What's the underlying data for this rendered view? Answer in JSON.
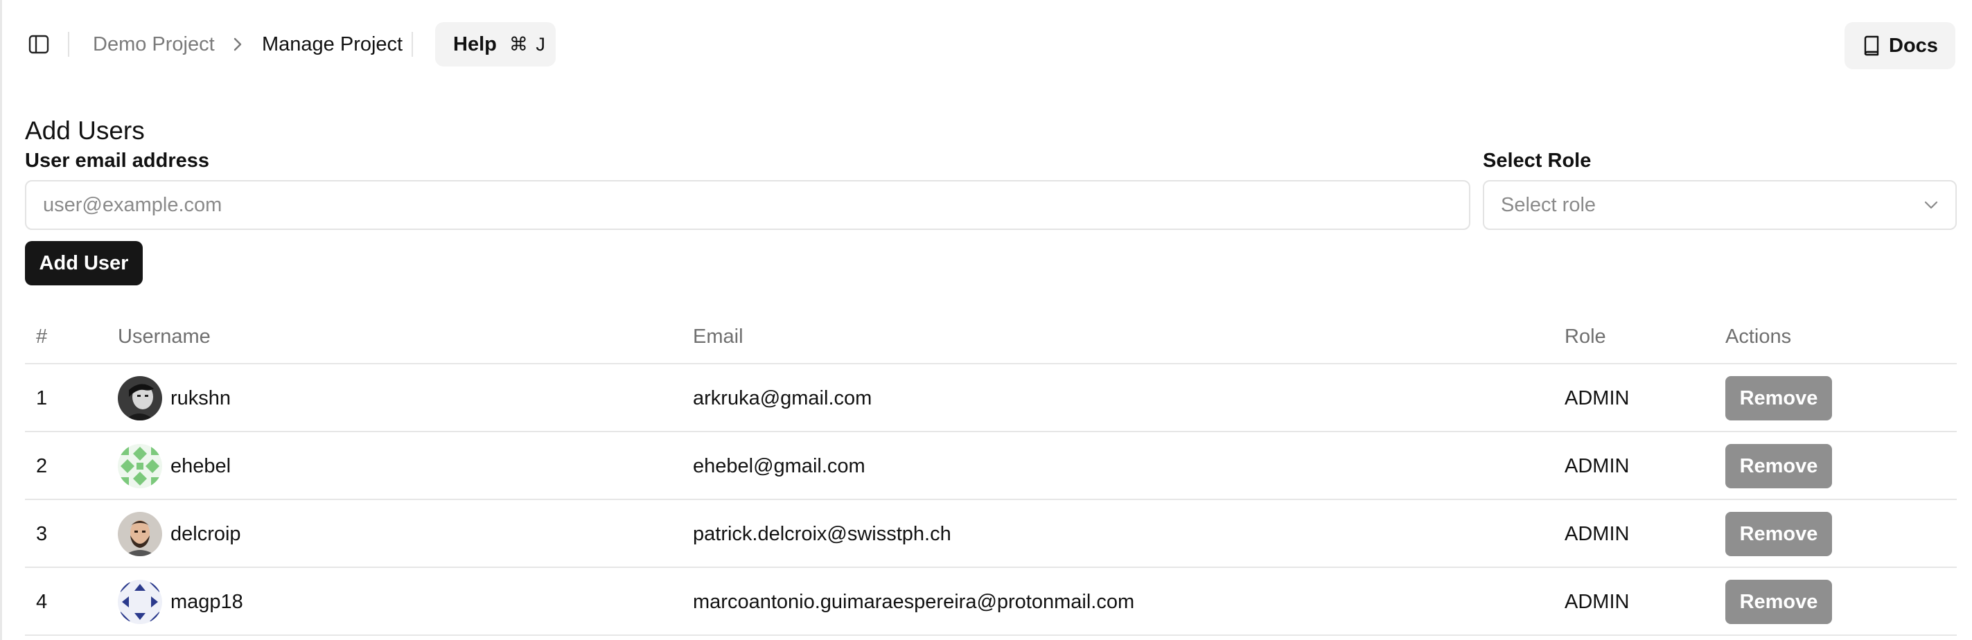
{
  "header": {
    "breadcrumb": [
      "Demo Project",
      "Manage Project"
    ],
    "help_label": "Help",
    "help_shortcut": "⌘ J",
    "docs_label": "Docs"
  },
  "form": {
    "title": "Add Users",
    "email_label": "User email address",
    "email_placeholder": "user@example.com",
    "email_value": "",
    "role_label": "Select Role",
    "role_placeholder": "Select role",
    "submit_label": "Add User"
  },
  "table": {
    "columns": [
      "#",
      "Username",
      "Email",
      "Role",
      "Actions"
    ],
    "rows": [
      {
        "index": "1",
        "username": "rukshn",
        "email": "arkruka@gmail.com",
        "role": "ADMIN",
        "action": "Remove",
        "avatar": "photo-portrait-bw"
      },
      {
        "index": "2",
        "username": "ehebel",
        "email": "ehebel@gmail.com",
        "role": "ADMIN",
        "action": "Remove",
        "avatar": "identicon-green"
      },
      {
        "index": "3",
        "username": "delcroip",
        "email": "patrick.delcroix@swisstph.ch",
        "role": "ADMIN",
        "action": "Remove",
        "avatar": "photo-portrait"
      },
      {
        "index": "4",
        "username": "magp18",
        "email": "marcoantonio.guimaraespereira@protonmail.com",
        "role": "ADMIN",
        "action": "Remove",
        "avatar": "identicon-navy"
      }
    ]
  },
  "colors": {
    "primary_button": "#161616",
    "remove_button": "#8f8f8f",
    "muted_text": "#7a7a7a",
    "border": "#e3e3e3",
    "identicon_green": "#7cc97c",
    "identicon_navy": "#2b3a8c"
  }
}
